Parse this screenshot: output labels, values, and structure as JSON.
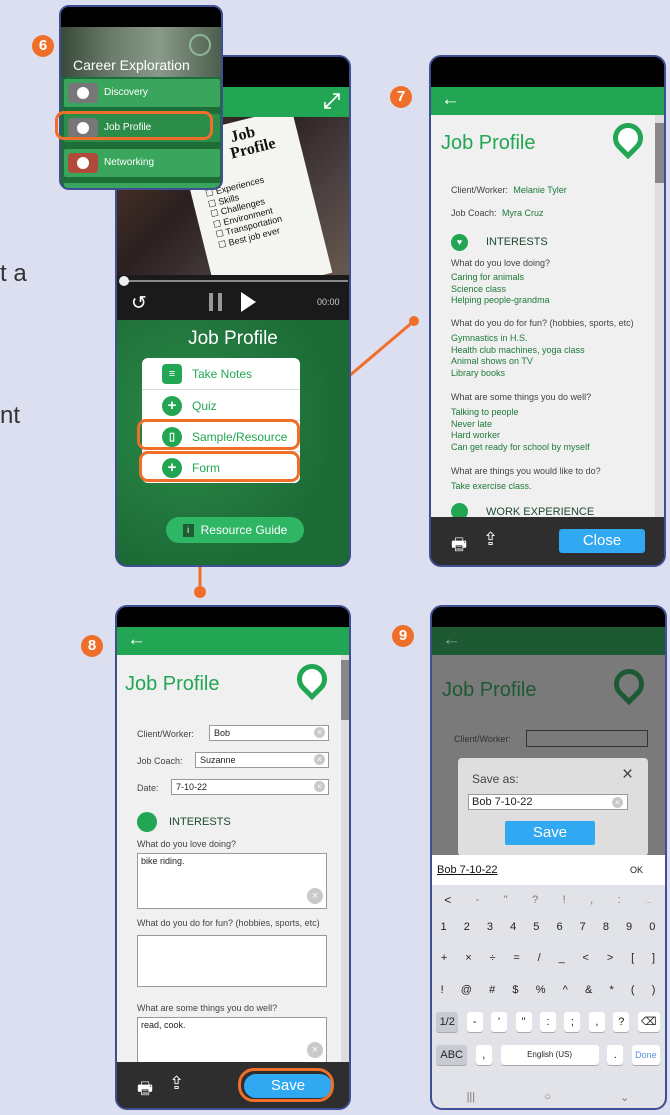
{
  "bg_text": {
    "a": "t a",
    "b": "nt"
  },
  "steps": {
    "s6": "6",
    "s7": "7",
    "s8": "8",
    "s9": "9"
  },
  "menu_panel": {
    "title": "Career Exploration",
    "items": [
      {
        "label": "Discovery"
      },
      {
        "label": "Job Profile"
      },
      {
        "label": "Networking"
      }
    ]
  },
  "video_screen": {
    "paper_title_1": "Job",
    "paper_title_2": "Profile",
    "checklist": [
      "Experiences",
      "Skills",
      "Challenges",
      "Environment",
      "Transportation",
      "Best job ever"
    ],
    "time": "00:00",
    "title": "Job Profile",
    "options": [
      {
        "label": "Take Notes",
        "icon": "notes-icon"
      },
      {
        "label": "Quiz",
        "icon": "plus-icon"
      },
      {
        "label": "Sample/Resource",
        "icon": "document-icon"
      },
      {
        "label": "Form",
        "icon": "plus-icon"
      }
    ],
    "resource_button": "Resource Guide"
  },
  "sample_screen": {
    "title": "Job Profile",
    "client_label": "Client/Worker:",
    "client_value": "Melanie Tyler",
    "coach_label": "Job Coach:",
    "coach_value": "Myra Cruz",
    "section_interests": "INTERESTS",
    "q1": "What do you love doing?",
    "a1": [
      "Caring for animals",
      "Science class",
      "Helping people-grandma"
    ],
    "q2": "What do you do for fun? (hobbies, sports, etc)",
    "a2": [
      "Gymnastics in H.S.",
      "Health club machines, yoga class",
      "Animal shows on TV",
      "Library books"
    ],
    "q3": "What are some things you do well?",
    "a3": [
      "Talking to people",
      "Never late",
      "Hard worker",
      "Can get ready for school by myself"
    ],
    "q4": "What are things you would like to do?",
    "a4": [
      "Take exercise class."
    ],
    "section_work": "WORK EXPERIENCE",
    "close_button": "Close"
  },
  "form_screen": {
    "title": "Job Profile",
    "client_label": "Client/Worker:",
    "client_value": "Bob",
    "coach_label": "Job Coach:",
    "coach_value": "Suzanne",
    "date_label": "Date:",
    "date_value": "7-10-22",
    "section_interests": "INTERESTS",
    "q1": "What do you love doing?",
    "a1": "bike riding.",
    "q2": "What do you do for fun? (hobbies, sports, etc)",
    "a2": "",
    "q3": "What are some things you do well?",
    "a3": "read, cook.",
    "save_button": "Save"
  },
  "save_screen": {
    "title": "Job Profile",
    "client_label": "Client/Worker:",
    "dialog_title": "Save as:",
    "dialog_value": "Bob 7-10-22",
    "dialog_save": "Save",
    "suggestion": "Bob 7-10-22",
    "ok": "OK",
    "keyboard": {
      "row0": [
        "<",
        "-",
        "\"",
        "?",
        "!",
        ",",
        ":",
        "..."
      ],
      "row1": [
        "1",
        "2",
        "3",
        "4",
        "5",
        "6",
        "7",
        "8",
        "9",
        "0"
      ],
      "row2": [
        "+",
        "×",
        "÷",
        "=",
        "/",
        "_",
        "<",
        ">",
        "[",
        "]"
      ],
      "row3": [
        "!",
        "@",
        "#",
        "$",
        "%",
        "^",
        "&",
        "*",
        "(",
        ")"
      ],
      "row4": [
        "1/2",
        "-",
        "'",
        "\"",
        ":",
        ";",
        ",",
        "?",
        "⌫"
      ],
      "row5_left": "ABC",
      "row5_comma": ",",
      "row5_space": "English (US)",
      "row5_dot": ".",
      "row5_done": "Done"
    }
  },
  "colors": {
    "accent": "#ef6f2a",
    "green": "#22a654",
    "dark_green": "#1e6e37",
    "background": "#dcdff0"
  }
}
